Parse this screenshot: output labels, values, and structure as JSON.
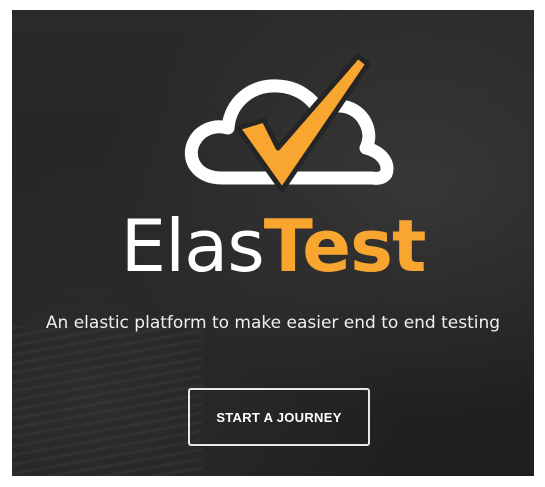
{
  "hero": {
    "brand_part1": "Elas",
    "brand_part2": "Test",
    "tagline": "An elastic platform to make easier end to end testing",
    "cta_label": "START A JOURNEY"
  },
  "icons": {
    "logo": "cloud-checkmark-icon"
  },
  "colors": {
    "accent": "#f9a630",
    "background": "#252525",
    "text": "#ffffff"
  }
}
